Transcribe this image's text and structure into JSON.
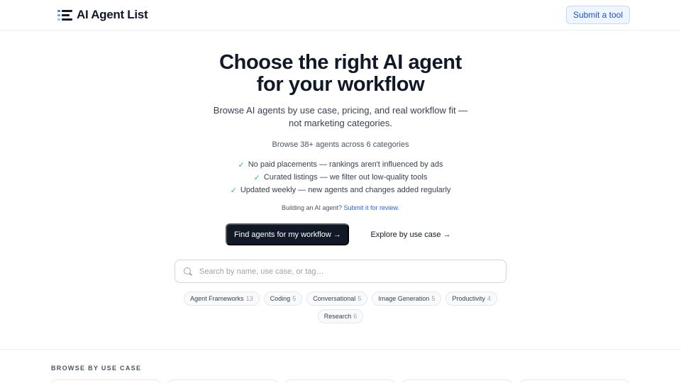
{
  "header": {
    "logo_text": "AI Agent List",
    "submit_label": "Submit a tool"
  },
  "hero": {
    "title_line1": "Choose the right AI agent",
    "title_line2": "for your workflow",
    "subtitle": "Browse AI agents by use case, pricing, and real workflow fit — not marketing categories.",
    "browse_count": "Browse 38+ agents across 6 categories",
    "checks": [
      "No paid placements — rankings aren't influenced by ads",
      "Curated listings — we filter out low-quality tools",
      "Updated weekly — new agents and changes added regularly"
    ],
    "building_text": "Building an AI agent?",
    "building_link": "Submit it for review."
  },
  "cta": {
    "primary": "Find agents for my workflow →",
    "secondary": "Explore by use case →"
  },
  "search": {
    "placeholder": "Search by name, use case, or tag…",
    "value": ""
  },
  "tags": [
    {
      "label": "Agent Frameworks",
      "count": "13"
    },
    {
      "label": "Coding",
      "count": "5"
    },
    {
      "label": "Conversational",
      "count": "5"
    },
    {
      "label": "Image Generation",
      "count": "5"
    },
    {
      "label": "Productivity",
      "count": "4"
    },
    {
      "label": "Research",
      "count": "6"
    }
  ],
  "section": {
    "label": "BROWSE BY USE CASE"
  },
  "colors": {
    "primary_button": "#111827",
    "link": "#2563eb",
    "check": "#22c55e",
    "submit_bg": "#eff6ff"
  }
}
